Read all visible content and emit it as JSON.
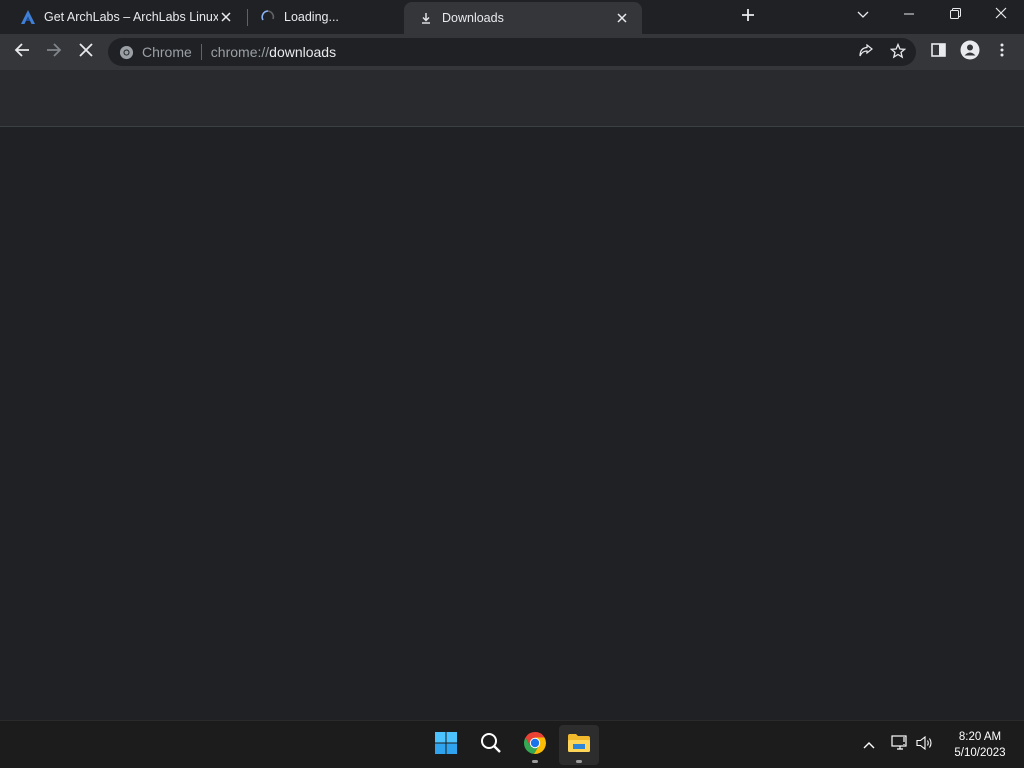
{
  "browser": {
    "tabs": [
      {
        "title": "Get ArchLabs – ArchLabs Linux",
        "icon": "archlabs-logo-icon",
        "active": false
      },
      {
        "title": "Loading...",
        "icon": "loading-spinner-icon",
        "active": false
      },
      {
        "title": "Downloads",
        "icon": "download-icon",
        "active": true
      }
    ],
    "new_tab_icon": "plus-icon",
    "omnibox": {
      "chip_label": "Chrome",
      "url_scheme": "chrome://",
      "url_path": "downloads"
    },
    "colors": {
      "frame": "#202124",
      "toolbar": "#35363a",
      "page_background": "#202124",
      "page_header": "#292a2d"
    }
  },
  "taskbar": {
    "apps": [
      "windows-start-icon",
      "search-icon",
      "chrome-icon",
      "file-explorer-icon"
    ],
    "clock": {
      "time": "8:20 AM",
      "date": "5/10/2023"
    }
  }
}
